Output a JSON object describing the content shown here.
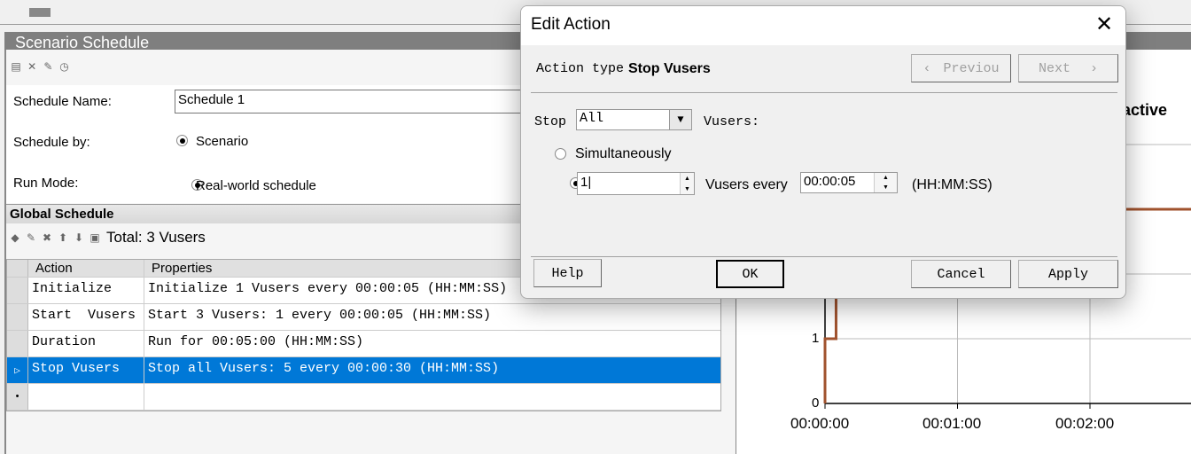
{
  "scenario_schedule": {
    "title": "Scenario Schedule",
    "schedule_name_label": "Schedule Name:",
    "schedule_name_value": "Schedule 1",
    "schedule_by_label": "Schedule by:",
    "schedule_by_value": "Scenario",
    "run_mode_label": "Run Mode:",
    "run_mode_value": "Real-world schedule"
  },
  "global_schedule": {
    "title": "Global Schedule",
    "total": "Total: 3 Vusers",
    "columns": [
      "Action",
      "Properties"
    ],
    "rows": [
      {
        "action": "Initialize",
        "properties": "Initialize 1 Vusers every 00:00:05 (HH:MM:SS)"
      },
      {
        "action": "Start  Vusers",
        "properties": "Start 3 Vusers: 1 every 00:00:05 (HH:MM:SS)"
      },
      {
        "action": "Duration",
        "properties": "Run for 00:05:00 (HH:MM:SS)"
      },
      {
        "action": "Stop Vusers",
        "properties": "Stop all Vusers: 5 every 00:00:30 (HH:MM:SS)",
        "selected": true
      }
    ]
  },
  "chart": {
    "title_partial": "eractive",
    "y_ticks": [
      "0",
      "1"
    ],
    "x_ticks": [
      "00:00:00",
      "00:01:00",
      "00:02:00"
    ],
    "line_color": "#a0522d"
  },
  "chart_data": {
    "type": "line",
    "x": [
      "00:00:00",
      "00:00:05",
      "00:00:10",
      "00:02:30"
    ],
    "series": [
      {
        "values": [
          1,
          2,
          3,
          3
        ]
      }
    ],
    "y_ticks": [
      0,
      1
    ],
    "x_ticks": [
      "00:00:00",
      "00:01:00",
      "00:02:00"
    ],
    "grid": true
  },
  "dialog": {
    "title": "Edit Action",
    "action_type_label": "Action type",
    "action_type_value": "Stop Vusers",
    "previous": "Previou",
    "next": "Next",
    "stop_label": "Stop",
    "stop_select": "All",
    "vusers_label": "Vusers:",
    "simultaneously": "Simultaneously",
    "count_value": "1",
    "vusers_every": "Vusers every",
    "interval_value": "00:00:05",
    "format": "(HH:MM:SS)",
    "help": "Help",
    "ok": "OK",
    "cancel": "Cancel",
    "apply": "Apply"
  }
}
